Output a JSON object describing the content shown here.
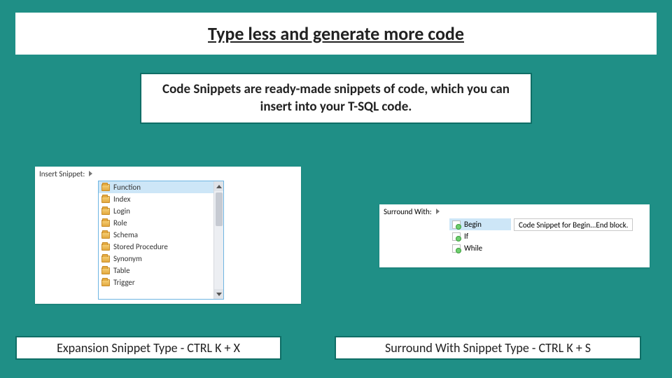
{
  "title": "Type less and generate more code",
  "intro": "Code Snippets are ready-made snippets of code, which you can insert into your T-SQL code.",
  "insert_snippet": {
    "crumb_label": "Insert Snippet:",
    "items": [
      "Function",
      "Index",
      "Login",
      "Role",
      "Schema",
      "Stored Procedure",
      "Synonym",
      "Table",
      "Trigger"
    ],
    "selected": "Function"
  },
  "surround_with": {
    "crumb_label": "Surround With:",
    "items": [
      "Begin",
      "If",
      "While"
    ],
    "selected": "Begin",
    "tooltip": "Code Snippet for Begin...End block."
  },
  "labels": {
    "left": "Expansion Snippet Type -  CTRL K + X",
    "right": "Surround With Snippet Type - CTRL K + S"
  }
}
